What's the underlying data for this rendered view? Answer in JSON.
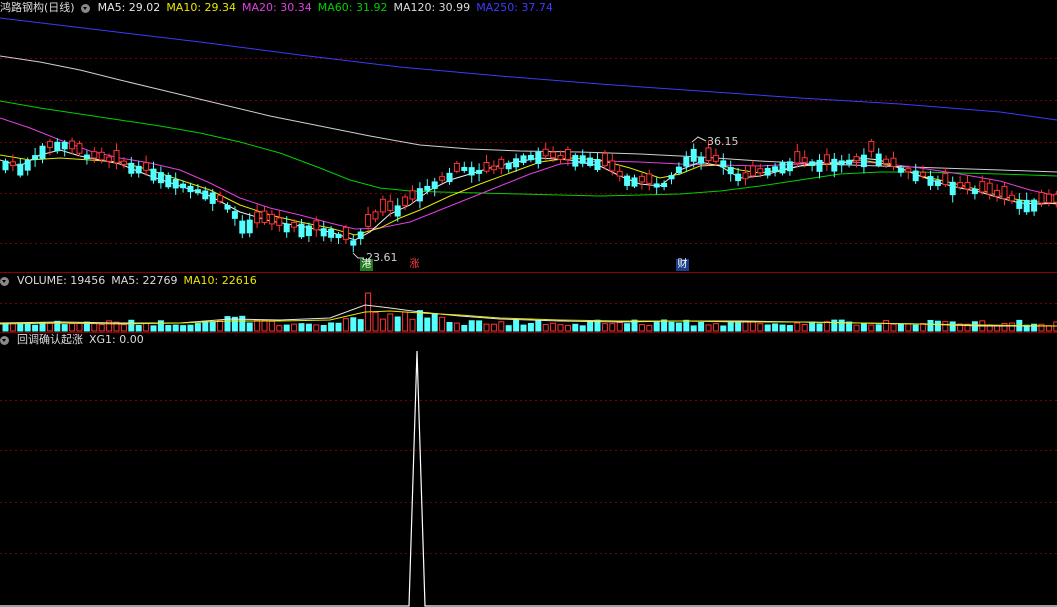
{
  "main_panel": {
    "title": "鸿路钢构(日线)",
    "ma_labels": [
      {
        "text": "MA5: 29.02",
        "color": "#e6e6e6"
      },
      {
        "text": "MA10: 29.34",
        "color": "#e8e800"
      },
      {
        "text": "MA20: 30.34",
        "color": "#e040e0"
      },
      {
        "text": "MA60: 31.92",
        "color": "#00d000"
      },
      {
        "text": "MA120: 30.99",
        "color": "#dcdcdc"
      },
      {
        "text": "MA250: 37.74",
        "color": "#3b3bff"
      }
    ],
    "high_label": "36.15",
    "low_label": "23.61",
    "markers": [
      {
        "text": "港",
        "bg": "#1f7a1f"
      },
      {
        "text": "涨",
        "bg": "#000000",
        "color": "#ff4040"
      },
      {
        "text": "财",
        "bg": "#1d3f8a"
      }
    ]
  },
  "volume_panel": {
    "labels": [
      {
        "text": "VOLUME: 19456",
        "color": "#dcdcdc"
      },
      {
        "text": "MA5: 22769",
        "color": "#dcdcdc"
      },
      {
        "text": "MA10: 22616",
        "color": "#e8e800"
      }
    ]
  },
  "indicator_panel": {
    "labels": [
      {
        "text": "回调确认起涨",
        "color": "#dcdcdc"
      },
      {
        "text": "XG1: 0.00",
        "color": "#dcdcdc"
      }
    ]
  },
  "colors": {
    "up": "#ff3232",
    "down": "#54ffff",
    "grid": "#7a0000"
  }
}
